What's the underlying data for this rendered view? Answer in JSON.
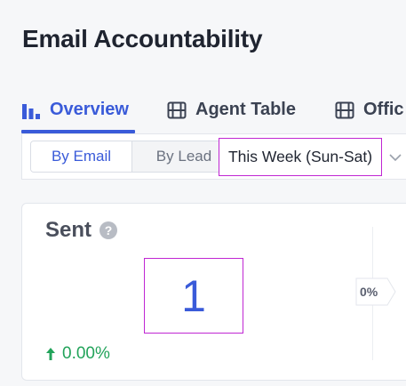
{
  "page": {
    "title": "Email Accountability"
  },
  "tabs": [
    {
      "label": "Overview",
      "icon": "bar-chart-icon",
      "active": true
    },
    {
      "label": "Agent Table",
      "icon": "table-icon",
      "active": false
    },
    {
      "label": "Offic",
      "icon": "table-icon",
      "active": false
    }
  ],
  "filters": {
    "segment": {
      "options": [
        "By Email",
        "By Lead"
      ],
      "selected": "By Email"
    },
    "date_range": {
      "selected": "This Week (Sun-Sat)",
      "icon": "chevron-down-icon"
    }
  },
  "card": {
    "title": "Sent",
    "help_icon": "?",
    "value": "1",
    "change": "0.00%",
    "change_direction": "up",
    "funnel_pct": "0%"
  },
  "colors": {
    "accent": "#3a5bd9",
    "positive": "#22a35a",
    "highlight_border": "#c026d3"
  }
}
